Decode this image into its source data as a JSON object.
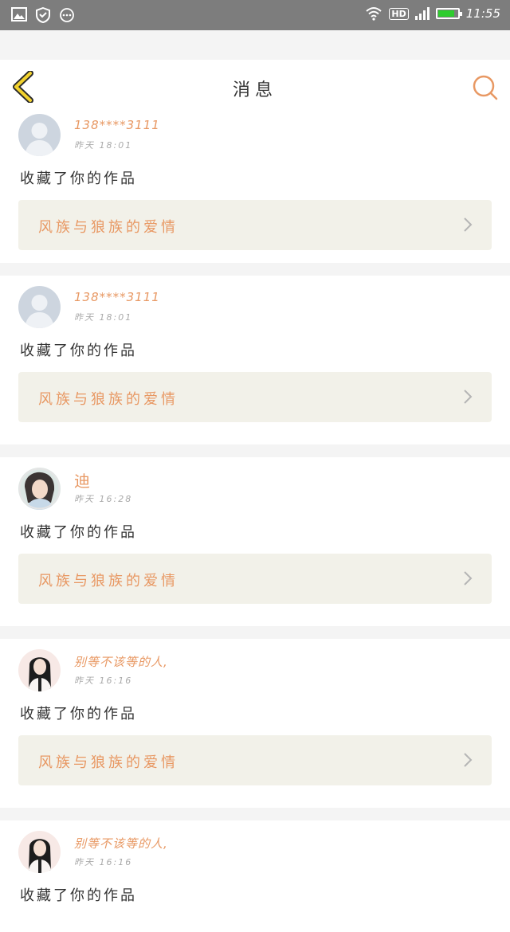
{
  "status_bar": {
    "time": "11:55",
    "network_badge": "HD",
    "battery_level": 0.85,
    "left_icons": [
      "gallery-icon",
      "shield-icon",
      "more-dots-icon"
    ],
    "right_icons": [
      "wifi-icon",
      "signal-icon",
      "battery-icon"
    ]
  },
  "nav": {
    "title": "消息",
    "back_icon": "chevron-left-icon",
    "search_icon": "search-icon"
  },
  "colors": {
    "accent": "#e89863",
    "back_arrow": "#f2d22e",
    "card_bg": "#ffffff",
    "work_bg": "#f2f1e9",
    "page_bg": "#f4f4f4"
  },
  "messages": [
    {
      "user": "138****3111",
      "time": "昨天 18:01",
      "action": "收藏了你的作品",
      "work": "风族与狼族的爱情",
      "avatar": "default"
    },
    {
      "user": "138****3111",
      "time": "昨天 18:01",
      "action": "收藏了你的作品",
      "work": "风族与狼族的爱情",
      "avatar": "default"
    },
    {
      "user": "迪",
      "time": "昨天 16:28",
      "action": "收藏了你的作品",
      "work": "风族与狼族的爱情",
      "avatar": "photo-a"
    },
    {
      "user": "别等不该等的人,",
      "time": "昨天 16:16",
      "action": "收藏了你的作品",
      "work": "风族与狼族的爱情",
      "avatar": "photo-b"
    },
    {
      "user": "别等不该等的人,",
      "time": "昨天 16:16",
      "action": "收藏了你的作品",
      "work": "",
      "avatar": "photo-b"
    }
  ]
}
